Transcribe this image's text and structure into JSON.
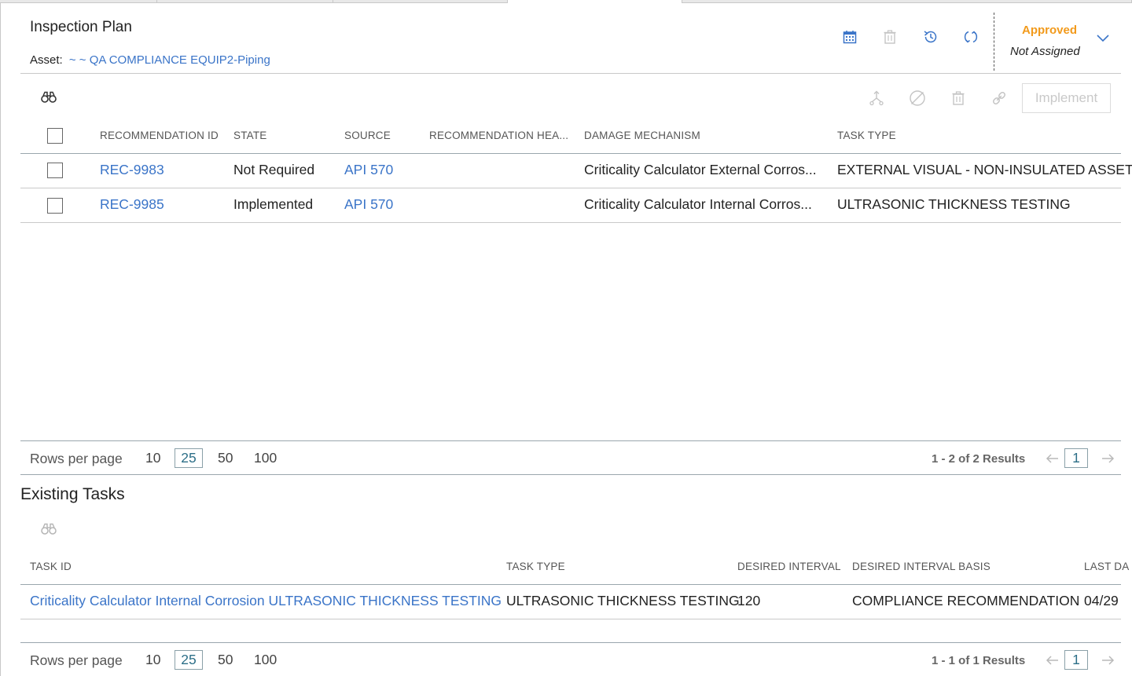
{
  "header": {
    "title": "Inspection Plan",
    "asset_label": "Asset:",
    "asset_link": "~ ~ QA COMPLIANCE EQUIP2-Piping",
    "status": "Approved",
    "assignment": "Not Assigned",
    "icons": [
      "calendar-icon",
      "trash-icon",
      "history-icon",
      "refresh-icon",
      "chevron-down-icon"
    ]
  },
  "recommendations": {
    "toolbar_icons": [
      "binoculars-icon",
      "merge-icon",
      "not-applicable-icon",
      "trash-icon",
      "link-icon"
    ],
    "implement_label": "Implement",
    "columns": [
      "RECOMMENDATION ID",
      "STATE",
      "SOURCE",
      "RECOMMENDATION HEA...",
      "DAMAGE MECHANISM",
      "TASK TYPE"
    ],
    "rows": [
      {
        "id": "REC-9983",
        "state": "Not Required",
        "source": "API 570",
        "header": "",
        "mechanism": "Criticality Calculator External Corros...",
        "task_type": "EXTERNAL VISUAL - NON-INSULATED ASSET"
      },
      {
        "id": "REC-9985",
        "state": "Implemented",
        "source": "API 570",
        "header": "",
        "mechanism": "Criticality Calculator Internal Corros...",
        "task_type": "ULTRASONIC THICKNESS TESTING"
      }
    ],
    "pager": {
      "rows_label": "Rows per page",
      "options": [
        "10",
        "25",
        "50",
        "100"
      ],
      "selected": "25",
      "results": "1 - 2 of 2 Results",
      "page": "1"
    }
  },
  "existing_tasks": {
    "title": "Existing Tasks",
    "columns": [
      "TASK ID",
      "TASK TYPE",
      "DESIRED INTERVAL",
      "DESIRED INTERVAL BASIS",
      "LAST DA"
    ],
    "rows": [
      {
        "task_id": "Criticality Calculator Internal Corrosion ULTRASONIC THICKNESS TESTING",
        "task_type": "ULTRASONIC THICKNESS TESTING",
        "interval": "120",
        "basis": "COMPLIANCE RECOMMENDATION",
        "last_date": "04/29"
      }
    ],
    "pager": {
      "rows_label": "Rows per page",
      "options": [
        "10",
        "25",
        "50",
        "100"
      ],
      "selected": "25",
      "results": "1 - 1 of 1 Results",
      "page": "1"
    }
  },
  "colors": {
    "link": "#3a74c8",
    "approved": "#f29a1b",
    "icon_active": "#3a74c8",
    "icon_disabled": "#c4c4c4"
  }
}
